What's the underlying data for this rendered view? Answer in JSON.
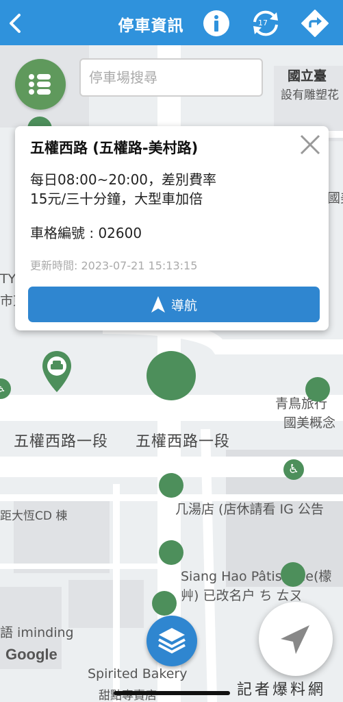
{
  "header": {
    "title": "停車資訊",
    "refresh_count": "17",
    "color": "#2f92dc"
  },
  "search": {
    "placeholder": "停車場搜尋"
  },
  "popup": {
    "title": "五權西路 (五權路-美村路)",
    "fee_line1": "每日08:00~20:00，差別費率",
    "fee_line2": "15元/三十分鐘，大型車加倍",
    "space_label": "車格編號 : 02600",
    "updated": "更新時間: 2023-07-21 15:13:15",
    "navigate_label": "導航"
  },
  "map": {
    "labels": {
      "univ_1": "國立臺",
      "univ_2": "設有雕塑花",
      "univ_3": "國美",
      "ty": "TY",
      "city": "市東",
      "road_1": "五權西路一段",
      "road_2": "五權西路一段",
      "bird_1": "青鳥旅行",
      "bird_2": "國美概念",
      "shop_1": "几湯店 (店休請看 IG 公告",
      "cd": "距大恆CD 棟",
      "siang_1": "Siang Hao Pâtisserie(檬",
      "siang_2": "艸) 已改名户 ち ㄊㄡ",
      "iminding": "語 iminding",
      "bakery_1": "Spirited Bakery",
      "bakery_2": "甜點專賣店"
    },
    "google": "Google",
    "watermark": "記者爆料網",
    "accent_green": "#4d8f5b"
  }
}
